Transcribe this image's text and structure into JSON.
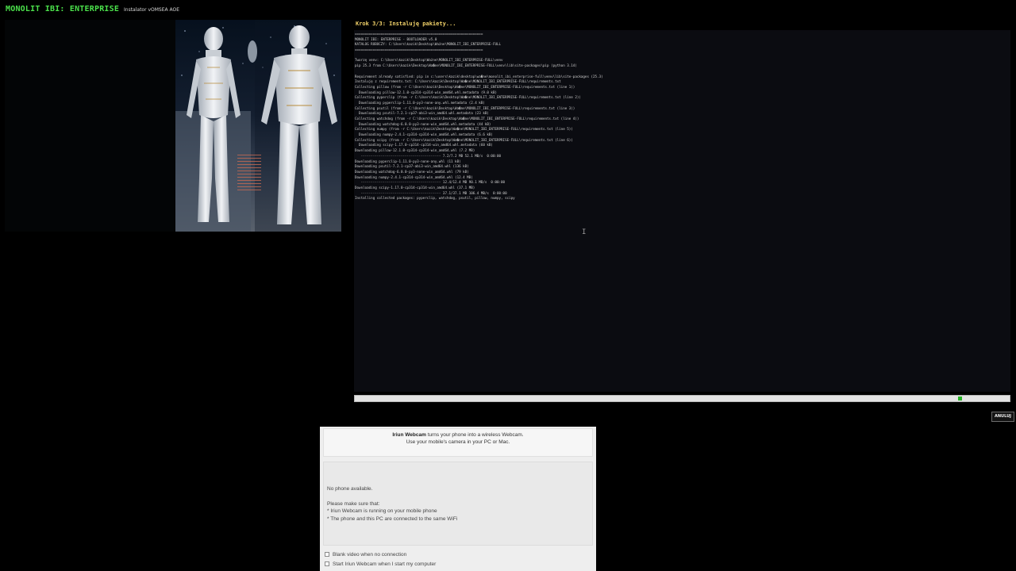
{
  "header": {
    "title": "MONOLIT IBI: ENTERPRISE",
    "subtitle": "Instalator vOMSEA AOE"
  },
  "installer": {
    "step": "Krok 3/3: Instaluję pakiety...",
    "console_lines": [
      "================================================================",
      "MONOLIT IBI: ENTERPRISE - BOOTLOADER v5.0",
      "KATALOG ROBOCZY: C:\\Users\\kazik\\Desktop\\Ważne\\MONOLIT_IBI_ENTERPRISE-FULL",
      "================================================================",
      "",
      "Tworzę venv: C:\\Users\\kazik\\Desktop\\Ważne\\MONOLIT_IBI_ENTERPRISE-FULL\\venv",
      "pip 25.3 from C:\\Users\\kazik\\Desktop\\Wa�ne\\MONOLIT_IBI_ENTERPRISE-FULL\\venv\\lib\\site-packages\\pip (python 3.14)",
      "",
      "Requirement already satisfied: pip in c:\\users\\kazik\\desktop\\wa�ne\\monolit_ibi_enterprise-full\\venv\\lib\\site-packages (25.3)",
      "Instaluję z requirements.txt: C:\\Users\\kazik\\Desktop\\Wa�ne\\MONOLIT_IBI_ENTERPRISE-FULL\\requirements.txt",
      "Collecting pillow (from -r C:\\Users\\kazik\\Desktop\\Wa�ne\\MONOLIT_IBI_ENTERPRISE-FULL\\requirements.txt (line 1))",
      "  Downloading pillow-12.1.0-cp314-cp314-win_amd64.whl.metadata (9.0 kB)",
      "Collecting pyperclip (from -r C:\\Users\\kazik\\Desktop\\Wa�ne\\MONOLIT_IBI_ENTERPRISE-FULL\\requirements.txt (line 2))",
      "  Downloading pyperclip-1.11.0-py3-none-any.whl.metadata (2.4 kB)",
      "Collecting psutil (from -r C:\\Users\\kazik\\Desktop\\Wa�ne\\MONOLIT_IBI_ENTERPRISE-FULL\\requirements.txt (line 3))",
      "  Downloading psutil-7.2.1-cp37-abi3-win_amd64.whl.metadata (23 kB)",
      "Collecting watchdog (from -r C:\\Users\\kazik\\Desktop\\Wa�ne\\MONOLIT_IBI_ENTERPRISE-FULL\\requirements.txt (line 4))",
      "  Downloading watchdog-6.0.0-py3-none-win_amd64.whl.metadata (44 kB)",
      "Collecting numpy (from -r C:\\Users\\kazik\\Desktop\\Wa�ne\\MONOLIT_IBI_ENTERPRISE-FULL\\requirements.txt (line 5))",
      "  Downloading numpy-2.4.1-cp314-cp314-win_amd64.whl.metadata (6.6 kB)",
      "Collecting scipy (from -r C:\\Users\\kazik\\Desktop\\Wa�ne\\MONOLIT_IBI_ENTERPRISE-FULL\\requirements.txt (line 6))",
      "  Downloading scipy-1.17.0-cp314-cp314-win_amd64.whl.metadata (60 kB)",
      "Downloading pillow-12.1.0-cp314-cp314-win_amd64.whl (7.2 MB)",
      "   ---------------------------------------- 7.2/7.2 MB 52.1 MB/s  0:00:00",
      "Downloading pyperclip-1.11.0-py3-none-any.whl (11 kB)",
      "Downloading psutil-7.2.1-cp37-abi3-win_amd64.whl (136 kB)",
      "Downloading watchdog-6.0.0-py3-none-win_amd64.whl (79 kB)",
      "Downloading numpy-2.4.1-cp314-cp314-win_amd64.whl (12.4 MB)",
      "   ---------------------------------------- 12.4/12.4 MB 90.1 MB/s  0:00:00",
      "Downloading scipy-1.17.0-cp314-cp314-win_amd64.whl (37.1 MB)",
      "   ---------------------------------------- 37.1/37.1 MB 106.4 MB/s  0:00:00",
      "Installing collected packages: pyperclip, watchdog, psutil, pillow, numpy, scipy"
    ],
    "progress": {
      "indicator_position": 0.927,
      "color": "#26b226"
    },
    "cancel_label": "ANULUJ"
  },
  "webcam_dialog": {
    "brand": "Iriun Webcam",
    "tagline": " turns your phone into a wireless Webcam.",
    "tagline2": "Use your mobile's camera in your PC or Mac.",
    "status": "No phone available.",
    "instructions_title": "Please make sure that:",
    "instructions": [
      "* Iriun Webcam is running on your mobile phone",
      "* The phone and this PC are connected to the same WiFi"
    ],
    "options": [
      {
        "label": "Blank video when no connection",
        "checked": false
      },
      {
        "label": "Start Iriun Webcam when I start my computer",
        "checked": false
      }
    ]
  },
  "colors": {
    "title": "#4be04b",
    "step": "#f3d36a",
    "console_bg": "#0b0c11"
  }
}
